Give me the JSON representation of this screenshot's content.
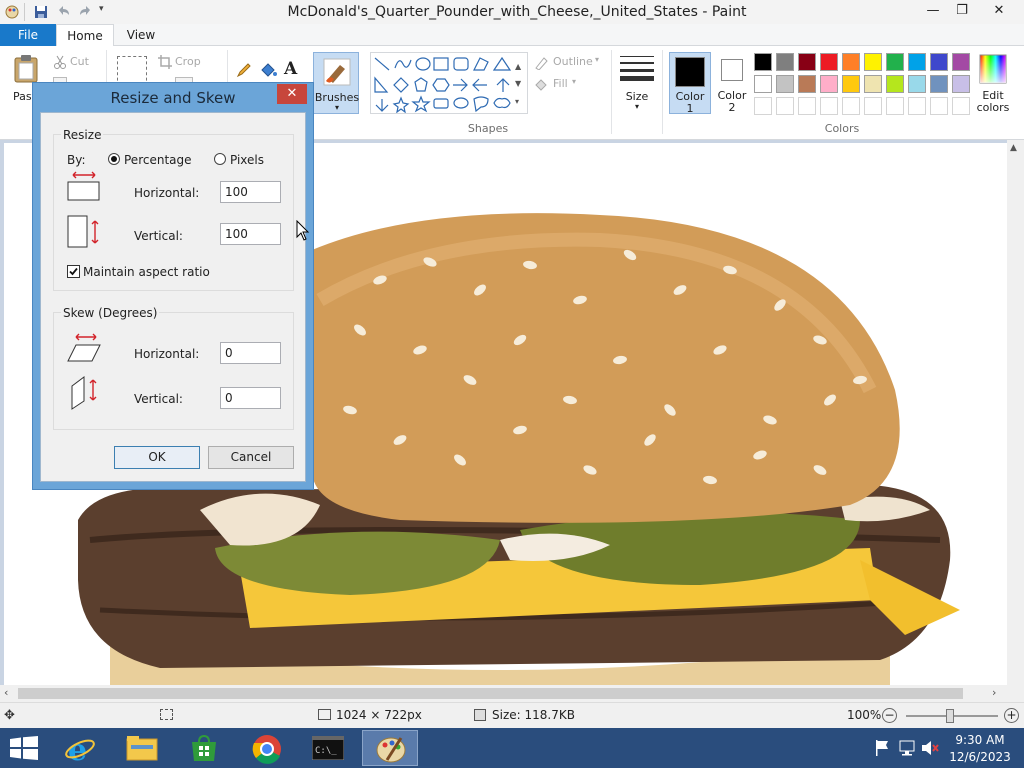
{
  "window": {
    "title": "McDonald's_Quarter_Pounder_with_Cheese,_United_States - Paint",
    "minimize": "—",
    "restore": "❐",
    "close": "✕"
  },
  "tabs": {
    "file": "File",
    "home": "Home",
    "view": "View"
  },
  "ribbon": {
    "paste": "Past",
    "cut": "Cut",
    "crop": "Crop",
    "brushes": "Brushes",
    "outline": "Outline",
    "fill": "Fill",
    "shapes_group": "Shapes",
    "size": "Size",
    "color1": "Color\n1",
    "color1_a": "Color",
    "color1_b": "1",
    "color2_a": "Color",
    "color2_b": "2",
    "colors_group": "Colors",
    "edit_colors_a": "Edit",
    "edit_colors_b": "colors"
  },
  "palette": {
    "row1": [
      "#000000",
      "#7f7f7f",
      "#880015",
      "#ed1c24",
      "#ff7f27",
      "#fff200",
      "#22b14c",
      "#00a2e8",
      "#3f48cc",
      "#a349a4"
    ],
    "row2": [
      "#ffffff",
      "#c3c3c3",
      "#b97a57",
      "#ffaec9",
      "#ffc90e",
      "#efe4b0",
      "#b5e61d",
      "#99d9ea",
      "#7092be",
      "#c8bfe7"
    ]
  },
  "dialog": {
    "title": "Resize and Skew",
    "close": "✕",
    "resize_group": "Resize",
    "by_label": "By:",
    "percentage": "Percentage",
    "pixels": "Pixels",
    "horizontal": "Horizontal:",
    "vertical": "Vertical:",
    "resize_h": "100",
    "resize_v": "100",
    "maintain": "Maintain aspect ratio",
    "skew_group": "Skew (Degrees)",
    "skew_h": "0",
    "skew_v": "0",
    "ok": "OK",
    "cancel": "Cancel"
  },
  "status": {
    "dimensions": "1024 × 722px",
    "size": "Size: 118.7KB",
    "zoom": "100%"
  },
  "clock": {
    "time": "9:30 AM",
    "date": "12/6/2023"
  }
}
